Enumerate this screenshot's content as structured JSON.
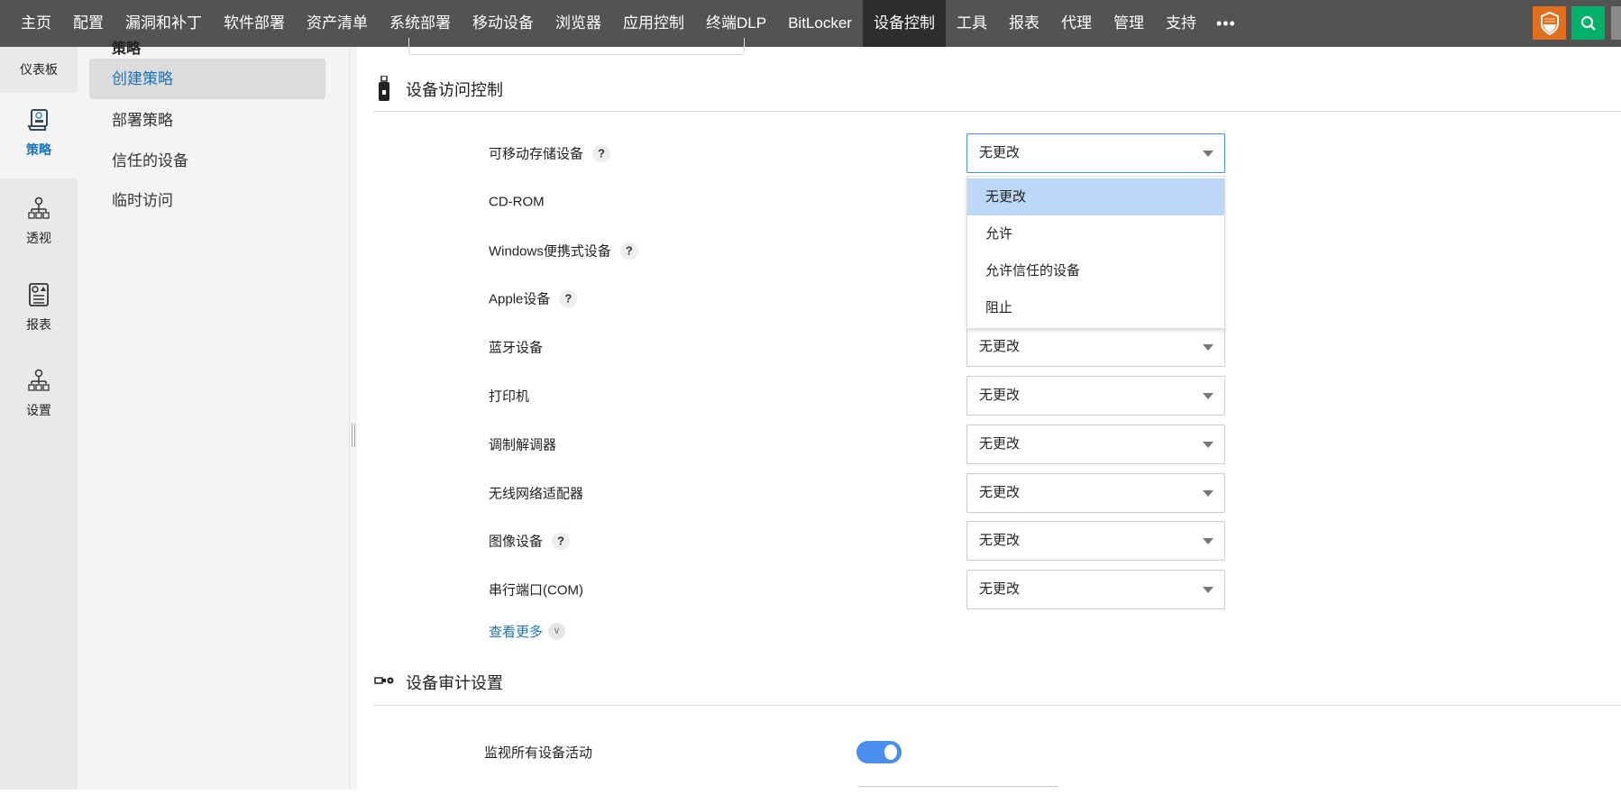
{
  "topnav": {
    "items": [
      "主页",
      "配置",
      "漏洞和补丁",
      "软件部署",
      "资产清单",
      "系统部署",
      "移动设备",
      "浏览器",
      "应用控制",
      "终端DLP",
      "BitLocker",
      "设备控制",
      "工具",
      "报表",
      "代理",
      "管理",
      "支持"
    ],
    "active": "设备控制",
    "more": "•••",
    "shield_color": "#e07020",
    "search_color": "#00b16a"
  },
  "rail": {
    "dashboard": "仪表板",
    "items": [
      {
        "label": "策略",
        "icon": "policy-scroll-icon",
        "active": true
      },
      {
        "label": "透视",
        "icon": "insight-hierarchy-icon"
      },
      {
        "label": "报表",
        "icon": "report-icon"
      },
      {
        "label": "设置",
        "icon": "settings-hierarchy-icon"
      }
    ]
  },
  "sub": {
    "heading": "策略",
    "items": [
      "创建策略",
      "部署策略",
      "信任的设备",
      "临时访问"
    ],
    "active": "创建策略"
  },
  "main": {
    "access_title": "设备访问控制",
    "rows": [
      {
        "label": "可移动存储设备",
        "help": true,
        "value": "无更改"
      },
      {
        "label": "CD-ROM",
        "help": false,
        "value": "无更改"
      },
      {
        "label": "Windows便携式设备",
        "help": true,
        "value": "无更改"
      },
      {
        "label": "Apple设备",
        "help": true,
        "value": "无更改"
      },
      {
        "label": "蓝牙设备",
        "help": false,
        "value": "无更改"
      },
      {
        "label": "打印机",
        "help": false,
        "value": "无更改"
      },
      {
        "label": "调制解调器",
        "help": false,
        "value": "无更改"
      },
      {
        "label": "无线网络适配器",
        "help": false,
        "value": "无更改"
      },
      {
        "label": "图像设备",
        "help": true,
        "value": "无更改"
      },
      {
        "label": "串行端口(COM)",
        "help": false,
        "value": "无更改"
      }
    ],
    "help_mark": "?",
    "dropdown_options": [
      "无更改",
      "允许",
      "允许信任的设备",
      "阻止"
    ],
    "dropdown_highlighted": "无更改",
    "see_more": "查看更多",
    "audit_title": "设备审计设置",
    "monitor_label": "监视所有设备活动",
    "monitor_enabled": true
  }
}
